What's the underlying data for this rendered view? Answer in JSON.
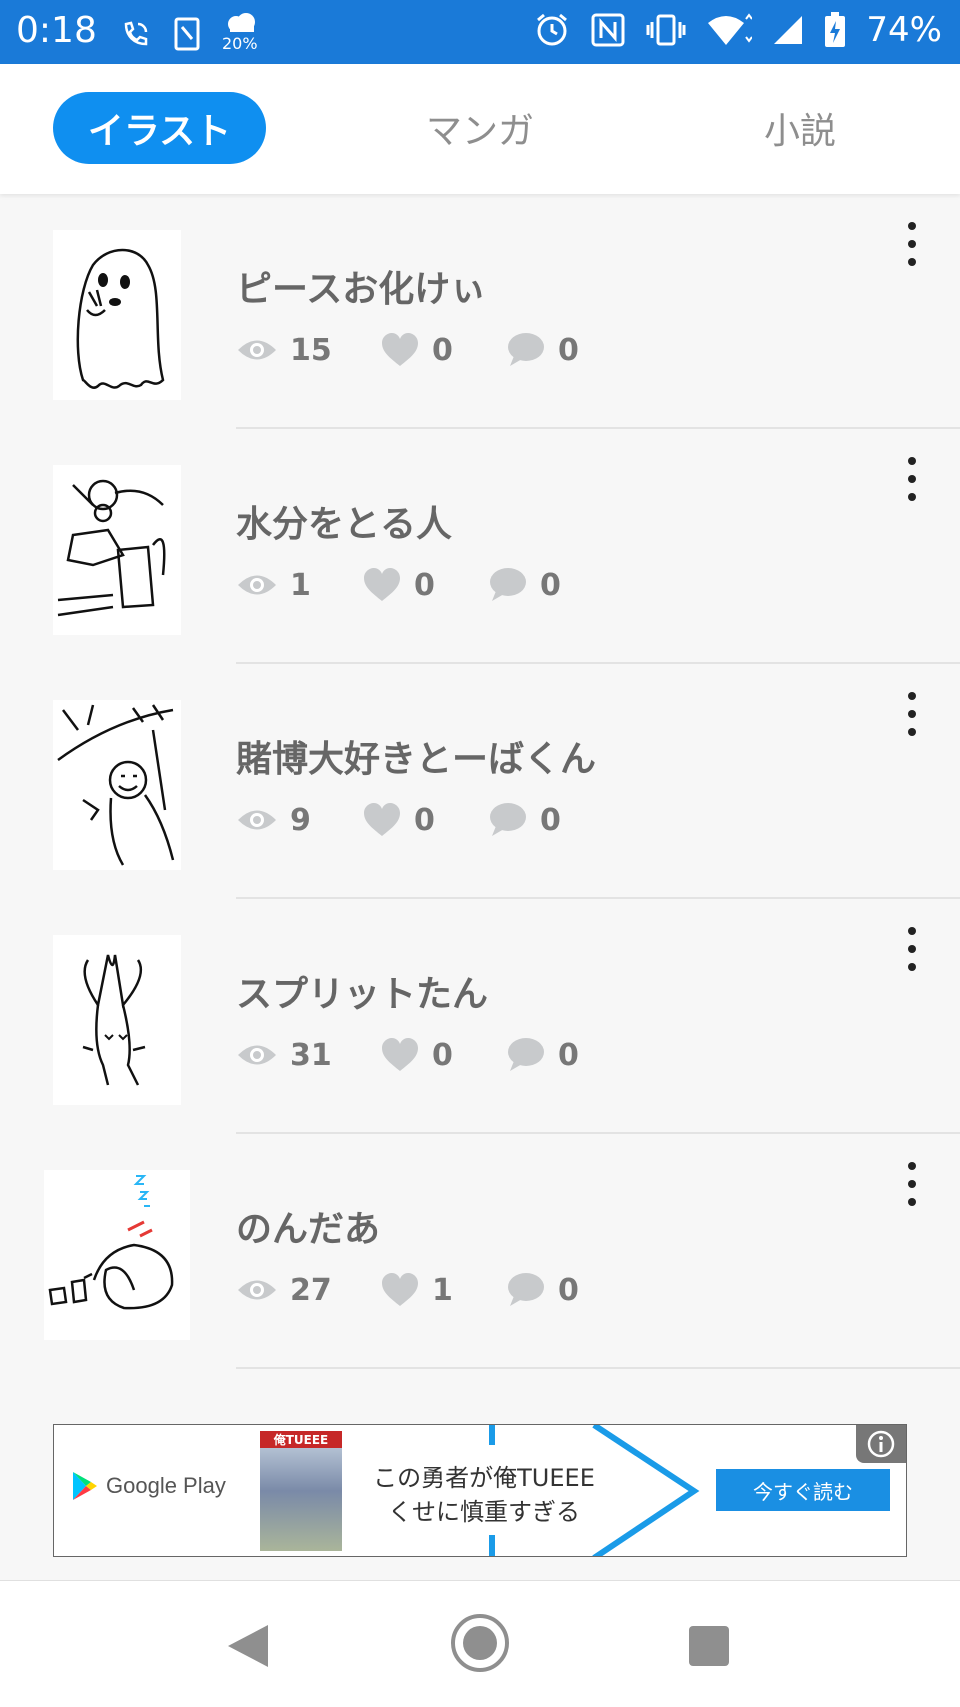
{
  "status_bar": {
    "time": "0:18",
    "weather_percent": "20%",
    "battery": "74%",
    "background_color": "#1a7ad8"
  },
  "tabs": [
    {
      "label": "イラスト",
      "active": true
    },
    {
      "label": "マンガ",
      "active": false
    },
    {
      "label": "小説",
      "active": false
    }
  ],
  "posts": [
    {
      "title": "ピースお化けぃ",
      "views": "15",
      "likes": "0",
      "comments": "0"
    },
    {
      "title": "水分をとる人",
      "views": "1",
      "likes": "0",
      "comments": "0"
    },
    {
      "title": "賭博大好きとーばくん",
      "views": "9",
      "likes": "0",
      "comments": "0"
    },
    {
      "title": "スプリットたん",
      "views": "31",
      "likes": "0",
      "comments": "0"
    },
    {
      "title": "のんだあ",
      "views": "27",
      "likes": "1",
      "comments": "0"
    }
  ],
  "ad": {
    "store": "Google Play",
    "cover_title": "俺TUEEE",
    "line1": "この勇者が俺TUEEE",
    "line2": "くせに慎重すぎる",
    "cta": "今すぐ読む"
  },
  "colors": {
    "accent": "#0f8ff0",
    "icon_gray": "#c8cacc"
  }
}
